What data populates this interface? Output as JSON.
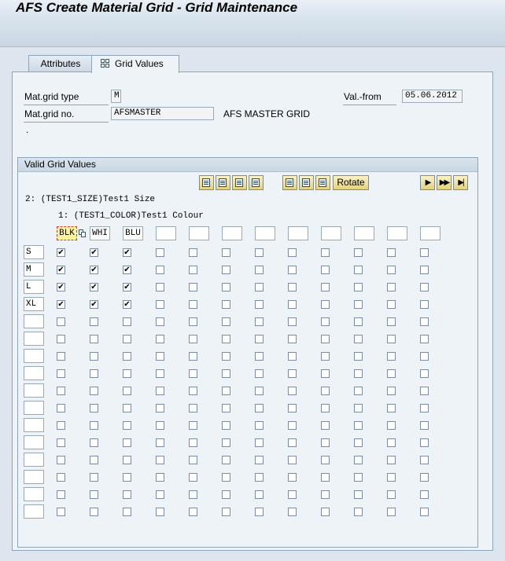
{
  "window": {
    "title": "AFS Create Material Grid - Grid Maintenance"
  },
  "tabs": [
    {
      "label": "Attributes",
      "active": false
    },
    {
      "label": "Grid Values",
      "active": true,
      "icon": "grid-icon"
    }
  ],
  "header": {
    "mat_grid_type_label": "Mat.grid type",
    "mat_grid_type_value": "M",
    "mat_grid_no_label": "Mat.grid no.",
    "mat_grid_no_value": "AFSMASTER",
    "mat_grid_desc": "AFS MASTER GRID",
    "val_from_label": "Val.-from",
    "val_from_value": "05.06.2012",
    "dot": "."
  },
  "grid": {
    "group_title": "Valid Grid Values",
    "rotate_label": "Rotate",
    "icon_buttons": [
      "select-all-icon",
      "deselect-all-icon",
      "select-block-icon",
      "deselect-block-icon",
      "copy-icon",
      "paste-icon",
      "delete-icon"
    ],
    "nav_buttons": [
      {
        "icon": "next-page-icon",
        "glyph": "▶"
      },
      {
        "icon": "next-block-icon",
        "glyph": "▶▶"
      },
      {
        "icon": "last-page-icon",
        "glyph": "▶|"
      }
    ],
    "dim2_label": "2: (TEST1_SIZE)Test1 Size",
    "dim1_label": "1: (TEST1_COLOR)Test1 Colour",
    "columns": [
      "BLK",
      "WHI",
      "BLU",
      "",
      "",
      "",
      "",
      "",
      "",
      "",
      "",
      ""
    ],
    "rows": [
      "S",
      "M",
      "L",
      "XL",
      "",
      "",
      "",
      "",
      "",
      "",
      "",
      "",
      "",
      "",
      "",
      ""
    ],
    "checked": [
      [
        true,
        true,
        true,
        false,
        false,
        false,
        false,
        false,
        false,
        false,
        false,
        false
      ],
      [
        true,
        true,
        true,
        false,
        false,
        false,
        false,
        false,
        false,
        false,
        false,
        false
      ],
      [
        true,
        true,
        true,
        false,
        false,
        false,
        false,
        false,
        false,
        false,
        false,
        false
      ],
      [
        true,
        true,
        true,
        false,
        false,
        false,
        false,
        false,
        false,
        false,
        false,
        false
      ],
      [
        false,
        false,
        false,
        false,
        false,
        false,
        false,
        false,
        false,
        false,
        false,
        false
      ],
      [
        false,
        false,
        false,
        false,
        false,
        false,
        false,
        false,
        false,
        false,
        false,
        false
      ],
      [
        false,
        false,
        false,
        false,
        false,
        false,
        false,
        false,
        false,
        false,
        false,
        false
      ],
      [
        false,
        false,
        false,
        false,
        false,
        false,
        false,
        false,
        false,
        false,
        false,
        false
      ],
      [
        false,
        false,
        false,
        false,
        false,
        false,
        false,
        false,
        false,
        false,
        false,
        false
      ],
      [
        false,
        false,
        false,
        false,
        false,
        false,
        false,
        false,
        false,
        false,
        false,
        false
      ],
      [
        false,
        false,
        false,
        false,
        false,
        false,
        false,
        false,
        false,
        false,
        false,
        false
      ],
      [
        false,
        false,
        false,
        false,
        false,
        false,
        false,
        false,
        false,
        false,
        false,
        false
      ],
      [
        false,
        false,
        false,
        false,
        false,
        false,
        false,
        false,
        false,
        false,
        false,
        false
      ],
      [
        false,
        false,
        false,
        false,
        false,
        false,
        false,
        false,
        false,
        false,
        false,
        false
      ],
      [
        false,
        false,
        false,
        false,
        false,
        false,
        false,
        false,
        false,
        false,
        false,
        false
      ],
      [
        false,
        false,
        false,
        false,
        false,
        false,
        false,
        false,
        false,
        false,
        false,
        false
      ]
    ]
  }
}
